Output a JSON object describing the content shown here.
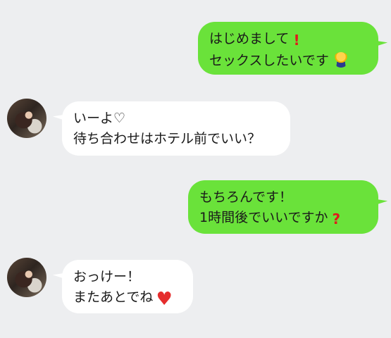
{
  "messages": [
    {
      "side": "sent",
      "lines": [
        "はじめまして",
        "セックスしたいです"
      ],
      "marks": [
        "exclamation-icon",
        "bowing-person-icon"
      ]
    },
    {
      "side": "received",
      "lines": [
        "いーよ♡",
        "待ち合わせはホテル前でいい？"
      ]
    },
    {
      "side": "sent",
      "lines": [
        "もちろんです！",
        "1時間後でいいですか"
      ],
      "marks": [
        "question-mark-icon"
      ]
    },
    {
      "side": "received",
      "lines": [
        "おっけー！",
        "またあとでね"
      ],
      "marks": [
        "heart-icon"
      ]
    }
  ],
  "colors": {
    "background": "#edeef0",
    "sent_bubble": "#6ae23a",
    "received_bubble": "#ffffff",
    "emoji_red": "#e01b1b"
  }
}
